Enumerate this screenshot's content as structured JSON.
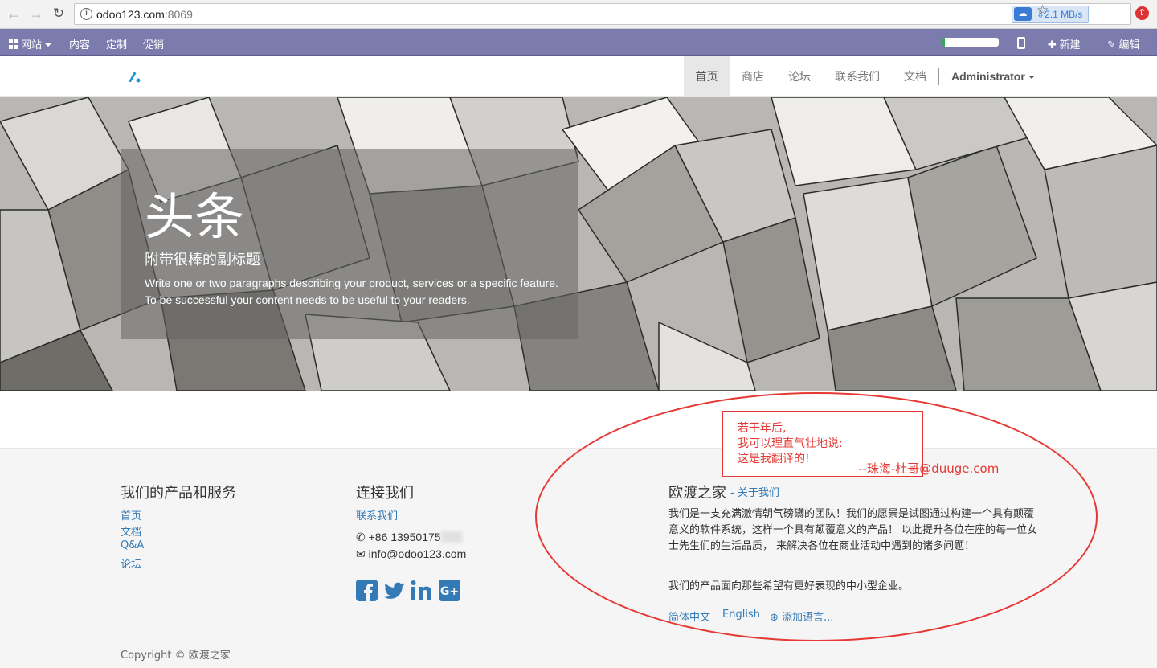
{
  "browser": {
    "url_host": "odoo123.com",
    "url_port": ":8069",
    "speed": "2.1 MB/s"
  },
  "editbar": {
    "website": "网站",
    "content": "内容",
    "customize": "定制",
    "promote": "促销",
    "new": "新建",
    "edit": "编辑",
    "progress_fraction": 0.05
  },
  "header": {
    "menu": [
      "首页",
      "商店",
      "论坛",
      "联系我们",
      "文档"
    ],
    "user": "Administrator"
  },
  "hero": {
    "title": "头条",
    "subtitle": "附带很棒的副标题",
    "text": "Write one or two paragraphs describing your product, services or a specific feature. To be successful your content needs to be useful to your readers."
  },
  "footer": {
    "products": {
      "heading": "我们的产品和服务",
      "links": [
        "首页",
        "文档",
        "Q&A",
        "论坛"
      ]
    },
    "connect": {
      "heading": "连接我们",
      "link": "联系我们",
      "phone": "+86 13950175",
      "email": "info@odoo123.com"
    },
    "about": {
      "heading": "欧渡之家",
      "link": "- 关于我们",
      "p1": "我们是一支充满激情朝气磅礴的团队！我们的愿景是试图通过构建一个具有颠覆意义的软件系统，这样一个具有颠覆意义的产品！ 以此提升各位在座的每一位女士先生们的生活品质， 来解决各位在商业活动中遇到的诸多问题！",
      "p2": "我们的产品面向那些希望有更好表现的中小型企业。"
    },
    "languages": [
      "简体中文",
      "English",
      "添加语言..."
    ],
    "copyright": "Copyright © 欧渡之家"
  },
  "annotation": {
    "lines": [
      "若干年后,",
      "我可以理直气壮地说:",
      "这是我翻译的!"
    ],
    "signature": "--珠海-杜哥@duuge.com",
    "color": "#e53935"
  },
  "colors": {
    "editbar": "#7c7bad",
    "link": "#337ab7"
  }
}
